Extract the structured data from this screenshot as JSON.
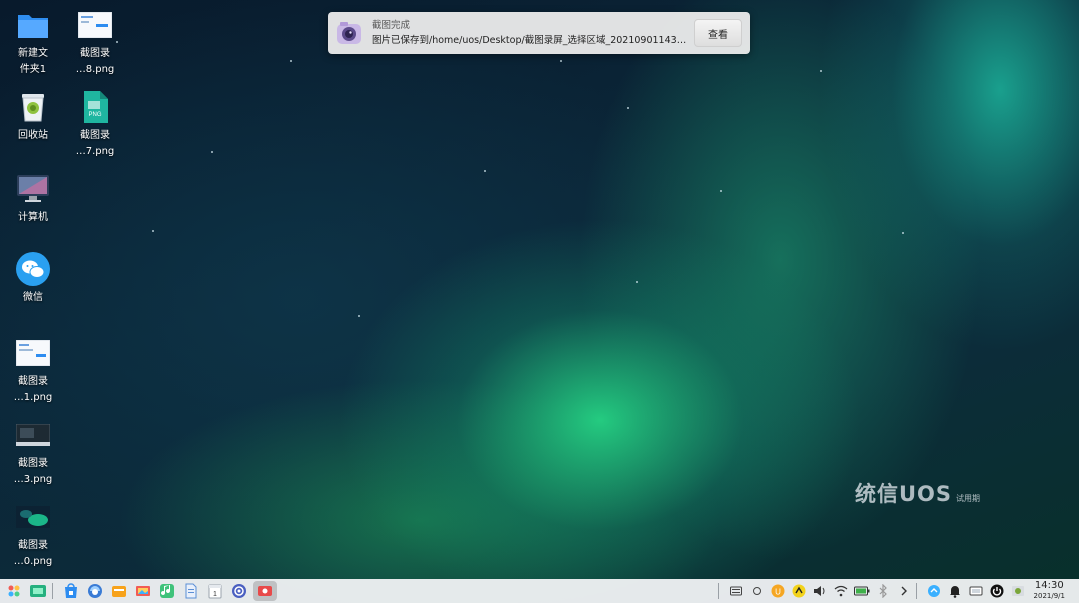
{
  "desktop_icons": [
    {
      "label": "新建文\n件夹1",
      "icon": "folder-icon"
    },
    {
      "label": "截图录\n…8.png",
      "icon": "screenshot-thumbnail-icon"
    },
    {
      "label": "回收站",
      "icon": "trash-icon"
    },
    {
      "label": "截图录\n…7.png",
      "icon": "png-file-icon"
    },
    {
      "label": "计算机",
      "icon": "computer-icon"
    },
    {
      "label": "微信",
      "icon": "wechat-icon"
    },
    {
      "label": "截图录\n…1.png",
      "icon": "screenshot-thumbnail-icon"
    },
    {
      "label": "截图录\n…3.png",
      "icon": "screenshot-thumbnail-icon"
    },
    {
      "label": "截图录\n…0.png",
      "icon": "screenshot-thumbnail-icon"
    }
  ],
  "notification": {
    "title": "截图完成",
    "body": "图片已保存到/home/uos/Desktop/截图录屏_选择区域_20210901143007.p…",
    "button_label": "查看",
    "icon": "camera-icon"
  },
  "watermark": {
    "main": "统信UOS",
    "sub": "试用期"
  },
  "taskbar": {
    "apps": [
      "launcher-icon",
      "multitask-view-icon",
      "app-store-icon",
      "browser-icon",
      "file-manager-icon",
      "gallery-icon",
      "music-icon",
      "document-viewer-icon",
      "calendar-icon",
      "settings-icon",
      "screen-recorder-icon"
    ],
    "tray": [
      "keyboard-icon",
      "circle-icon",
      "update-icon",
      "input-method-icon",
      "volume-icon",
      "wifi-icon",
      "battery-icon",
      "bluetooth-icon",
      "chevron-right-icon",
      "network-icon",
      "notification-bell-icon",
      "display-icon",
      "power-icon",
      "shield-icon"
    ],
    "time": "14:30",
    "date": "2021/9/1"
  },
  "colors": {
    "accent": "#2d8cf0",
    "taskbar_bg": "#eef0f2",
    "notification_bg": "#ececec"
  }
}
